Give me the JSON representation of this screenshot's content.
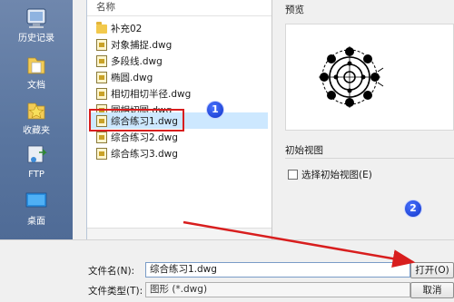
{
  "places": [
    {
      "label": "历史记录",
      "icon": "history-icon"
    },
    {
      "label": "文档",
      "icon": "documents-icon"
    },
    {
      "label": "收藏夹",
      "icon": "favorites-star-icon"
    },
    {
      "label": "FTP",
      "icon": "ftp-icon"
    },
    {
      "label": "桌面",
      "icon": "desktop-icon"
    }
  ],
  "file_list": {
    "column_header": "名称",
    "items": [
      {
        "name": "补充02",
        "type": "folder"
      },
      {
        "name": "对象捕捉.dwg",
        "type": "dwg"
      },
      {
        "name": "多段线.dwg",
        "type": "dwg"
      },
      {
        "name": "椭圆.dwg",
        "type": "dwg"
      },
      {
        "name": "相切相切半径.dwg",
        "type": "dwg"
      },
      {
        "name": "圆相切圆.dwg",
        "type": "dwg"
      },
      {
        "name": "综合练习1.dwg",
        "type": "dwg",
        "selected": true
      },
      {
        "name": "综合练习2.dwg",
        "type": "dwg"
      },
      {
        "name": "综合练习3.dwg",
        "type": "dwg"
      }
    ]
  },
  "preview": {
    "label": "预览",
    "initial_view_label": "初始视图",
    "checkbox_label": "选择初始视图(E)",
    "checkbox_checked": false
  },
  "bottom": {
    "filename_label": "文件名(N):",
    "filename_value": "综合练习1.dwg",
    "filetype_label": "文件类型(T):",
    "filetype_value": "图形 (*.dwg)",
    "open_button": "打开(O)",
    "cancel_button": "取消"
  },
  "annotations": {
    "badge_1": "1",
    "badge_2": "2"
  },
  "colors": {
    "highlight": "#d81e1e",
    "badge": "#1a3fd6",
    "selection": "#cde8ff"
  }
}
